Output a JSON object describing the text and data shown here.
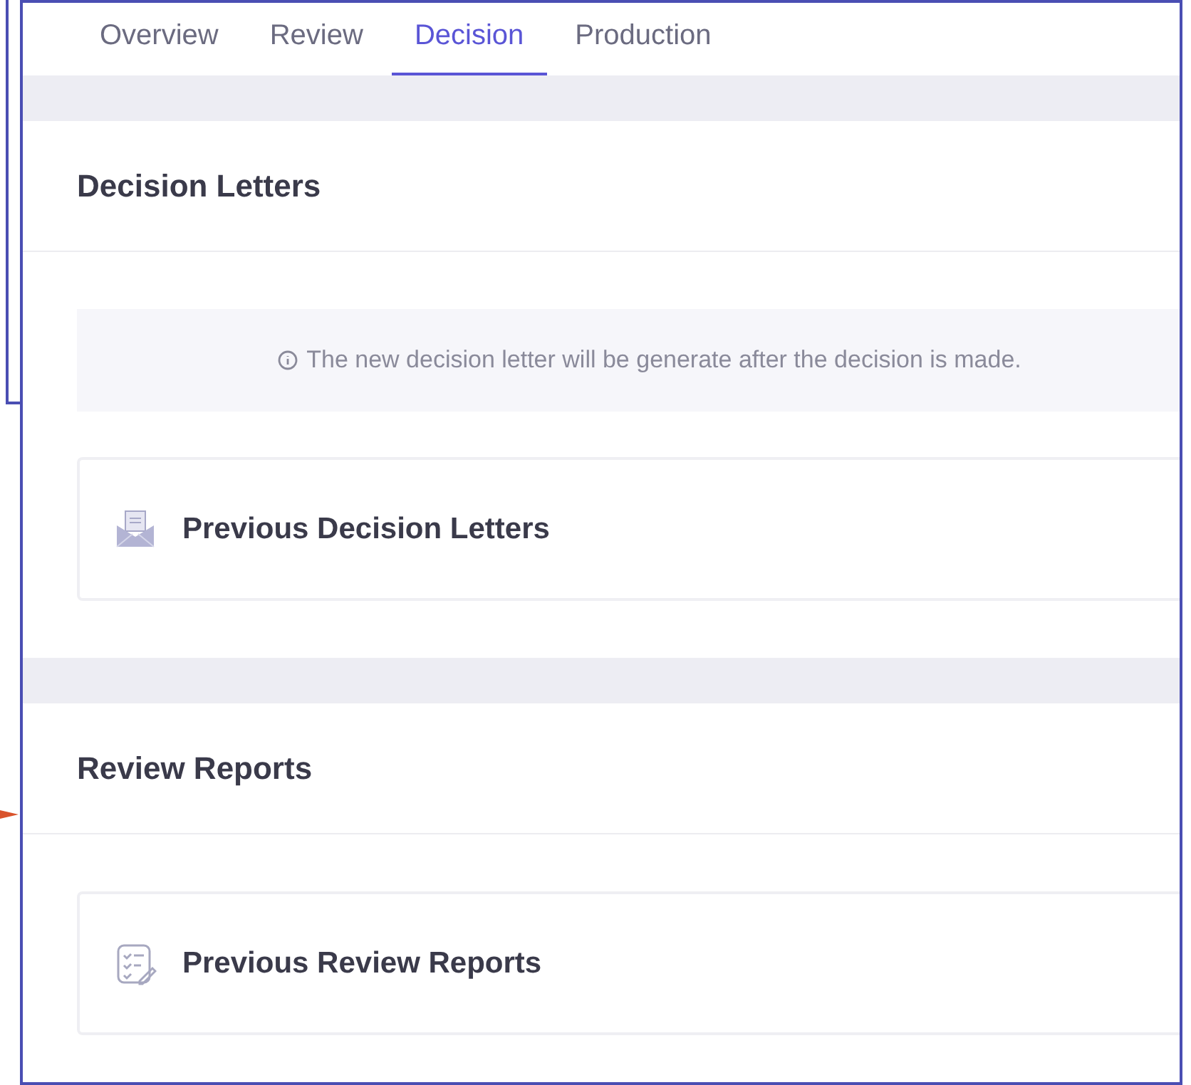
{
  "tabs": [
    {
      "label": "Overview",
      "selected": false
    },
    {
      "label": "Review",
      "selected": false
    },
    {
      "label": "Decision",
      "selected": true
    },
    {
      "label": "Production",
      "selected": false
    }
  ],
  "sections": [
    {
      "title": "Decision Letters",
      "notice": "The new decision letter will be generate after the decision is made.",
      "items": [
        {
          "kind": "letters",
          "label": "Previous Decision Letters"
        }
      ]
    },
    {
      "title": "Review Reports",
      "items": [
        {
          "kind": "reports",
          "label": "Previous Review Reports"
        }
      ]
    }
  ]
}
